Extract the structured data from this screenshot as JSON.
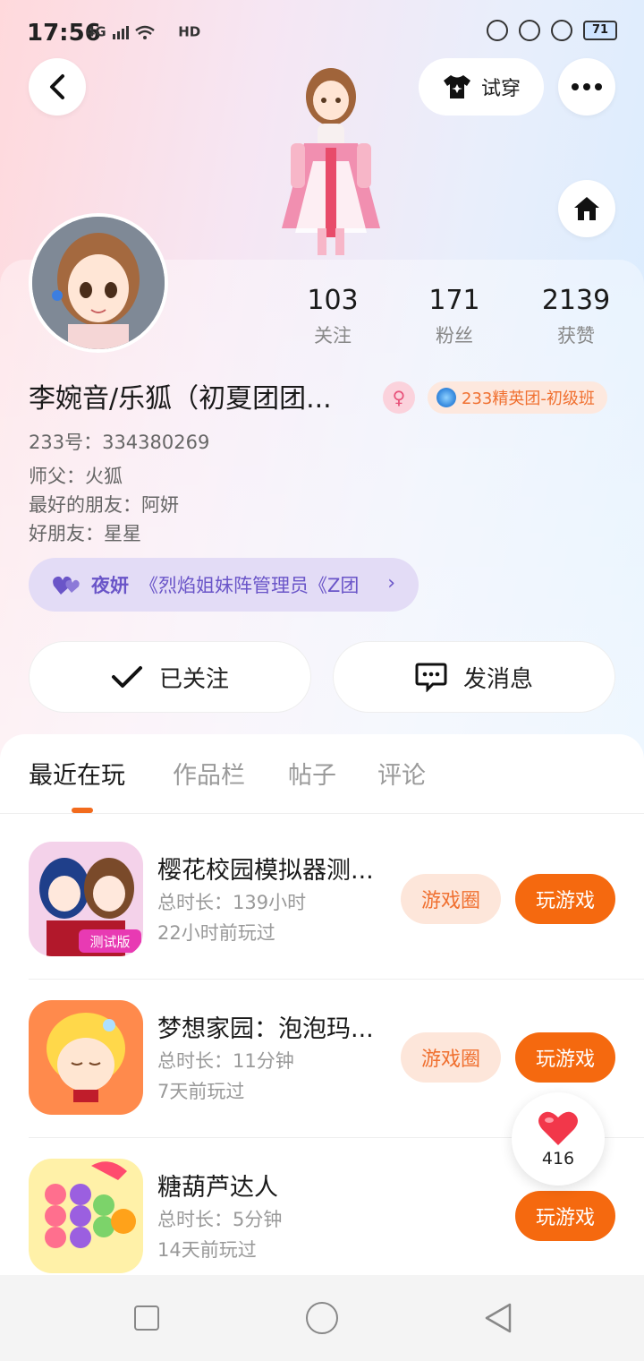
{
  "status_bar": {
    "time": "17:56",
    "network": "4G",
    "hd": "HD",
    "battery": "71"
  },
  "header": {
    "try_on_label": "试穿"
  },
  "profile": {
    "name": "李婉音/乐狐（初夏团团...",
    "badge": "233精英团-初级班",
    "id_line": "233号：334380269",
    "lines": [
      "师父：火狐",
      "最好的朋友：阿妍",
      "好朋友：星星"
    ],
    "stats": [
      {
        "value": "103",
        "label": "关注"
      },
      {
        "value": "171",
        "label": "粉丝"
      },
      {
        "value": "2139",
        "label": "获赞"
      }
    ],
    "relation": {
      "name": "夜妍",
      "text": "《烈焰姐妹阵管理员《Z团"
    },
    "follow_label": "已关注",
    "message_label": "发消息"
  },
  "tabs": [
    "最近在玩",
    "作品栏",
    "帖子",
    "评论"
  ],
  "games": [
    {
      "title": "樱花校园模拟器测...",
      "duration": "总时长：139小时",
      "last_played": "22小时前玩过",
      "circle_label": "游戏圈",
      "play_label": "玩游戏",
      "icon_tag": "测试版"
    },
    {
      "title": "梦想家园：泡泡玛...",
      "duration": "总时长：11分钟",
      "last_played": "7天前玩过",
      "circle_label": "游戏圈",
      "play_label": "玩游戏"
    },
    {
      "title": "糖葫芦达人",
      "duration": "总时长：5分钟",
      "last_played": "14天前玩过",
      "play_label": "玩游戏"
    }
  ],
  "like": {
    "count": "416"
  },
  "colors": {
    "accent": "#f5690f",
    "tab_indicator": "#f26b1d",
    "relation_text": "#6a55c8"
  }
}
